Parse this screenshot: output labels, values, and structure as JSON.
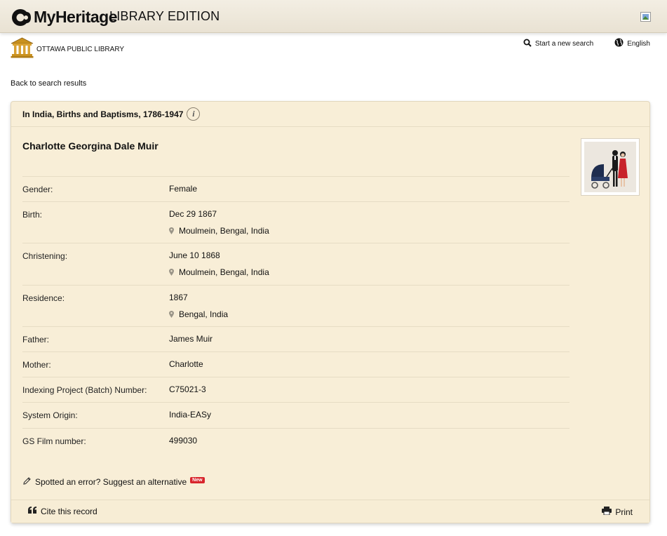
{
  "header": {
    "brand": "MyHeritage",
    "edition": "LIBRARY EDITION"
  },
  "library": {
    "name": "OTTAWA PUBLIC LIBRARY"
  },
  "toplinks": {
    "new_search": "Start a new search",
    "language": "English"
  },
  "back_link": "Back to search results",
  "record": {
    "collection": "In India, Births and Baptisms, 1786-1947",
    "name": "Charlotte Georgina Dale Muir",
    "rows": [
      {
        "label": "Gender:",
        "value": "Female"
      },
      {
        "label": "Birth:",
        "value": "Dec 29 1867",
        "place": "Moulmein, Bengal, India"
      },
      {
        "label": "Christening:",
        "value": "June 10 1868",
        "place": "Moulmein, Bengal, India"
      },
      {
        "label": "Residence:",
        "value": "1867",
        "place": "Bengal, India"
      },
      {
        "label": "Father:",
        "value": "James Muir"
      },
      {
        "label": "Mother:",
        "value": "Charlotte"
      },
      {
        "label": "Indexing Project (Batch) Number:",
        "value": "C75021-3"
      },
      {
        "label": "System Origin:",
        "value": "India-EASy"
      },
      {
        "label": "GS Film number:",
        "value": "499030"
      }
    ],
    "suggest": "Spotted an error? Suggest an alternative",
    "new_badge": "New"
  },
  "footer": {
    "cite": "Cite this record",
    "print": "Print"
  },
  "icons": {
    "logo": "myheritage-logo-icon",
    "library": "library-building-icon",
    "search": "search-icon",
    "globe": "globe-icon",
    "info": "info-icon",
    "pin": "map-pin-icon",
    "pencil": "pencil-icon",
    "quote": "quote-icon",
    "print": "printer-icon"
  },
  "colors": {
    "card_bg": "#f8eed7",
    "header_bg": "#ede6d7",
    "badge": "#d8252c"
  }
}
